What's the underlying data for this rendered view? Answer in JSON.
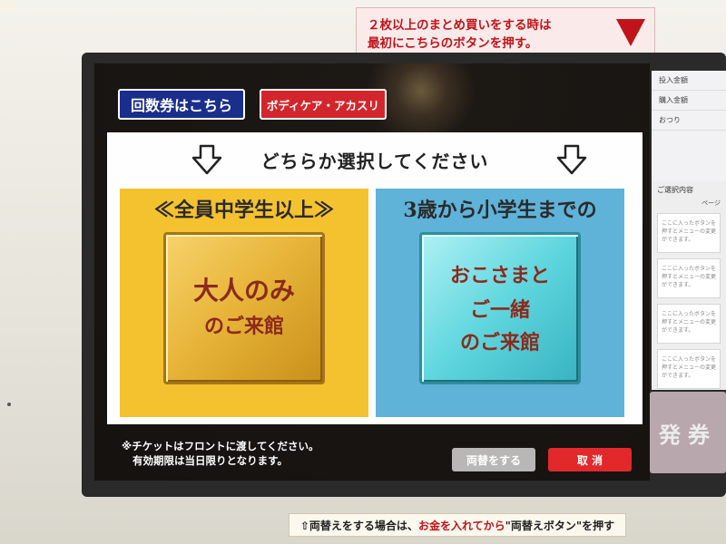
{
  "top_label": {
    "line1": "２枚以上のまとめ買いをする時は",
    "line2": "最初にこちらのボタンを押す。"
  },
  "top_buttons": {
    "kaisuken": "回数券はこちら",
    "body_care": "ボディケア・アカスリ"
  },
  "headline": "どちらか選択してください",
  "choices": {
    "adult": {
      "title": "≪全員中学生以上≫",
      "line1": "大人のみ",
      "line2": "のご来館"
    },
    "child": {
      "title": "3歳から小学生までの",
      "line1": "おこさまと",
      "line2": "ご一緒",
      "line3": "のご来館"
    }
  },
  "note": {
    "line1": "※チケットはフロントに渡してください。",
    "line2": "有効期限は当日限りとなります。"
  },
  "bottom_buttons": {
    "change": "両替をする",
    "cancel": "取 消"
  },
  "right_panel": {
    "rows": [
      "投入金額",
      "購入金額",
      "おつり"
    ],
    "selection_title": "ご選択内容",
    "page": "ページ",
    "slot_text": "ここに入ったボタンを押すとメニューの変更ができます。",
    "issue": "発券"
  },
  "bottom_label": {
    "pre": "⇧両替えをする場合は、",
    "red": "お金を入れてから",
    "post": "\"両替えボタン\"を押す"
  },
  "colors": {
    "adult_bg": "#f4c22f",
    "child_bg": "#5fb2d8",
    "kaisuken_bg": "#1a2e8c",
    "body_care_bg": "#d3262c",
    "cancel_bg": "#e3282c"
  }
}
